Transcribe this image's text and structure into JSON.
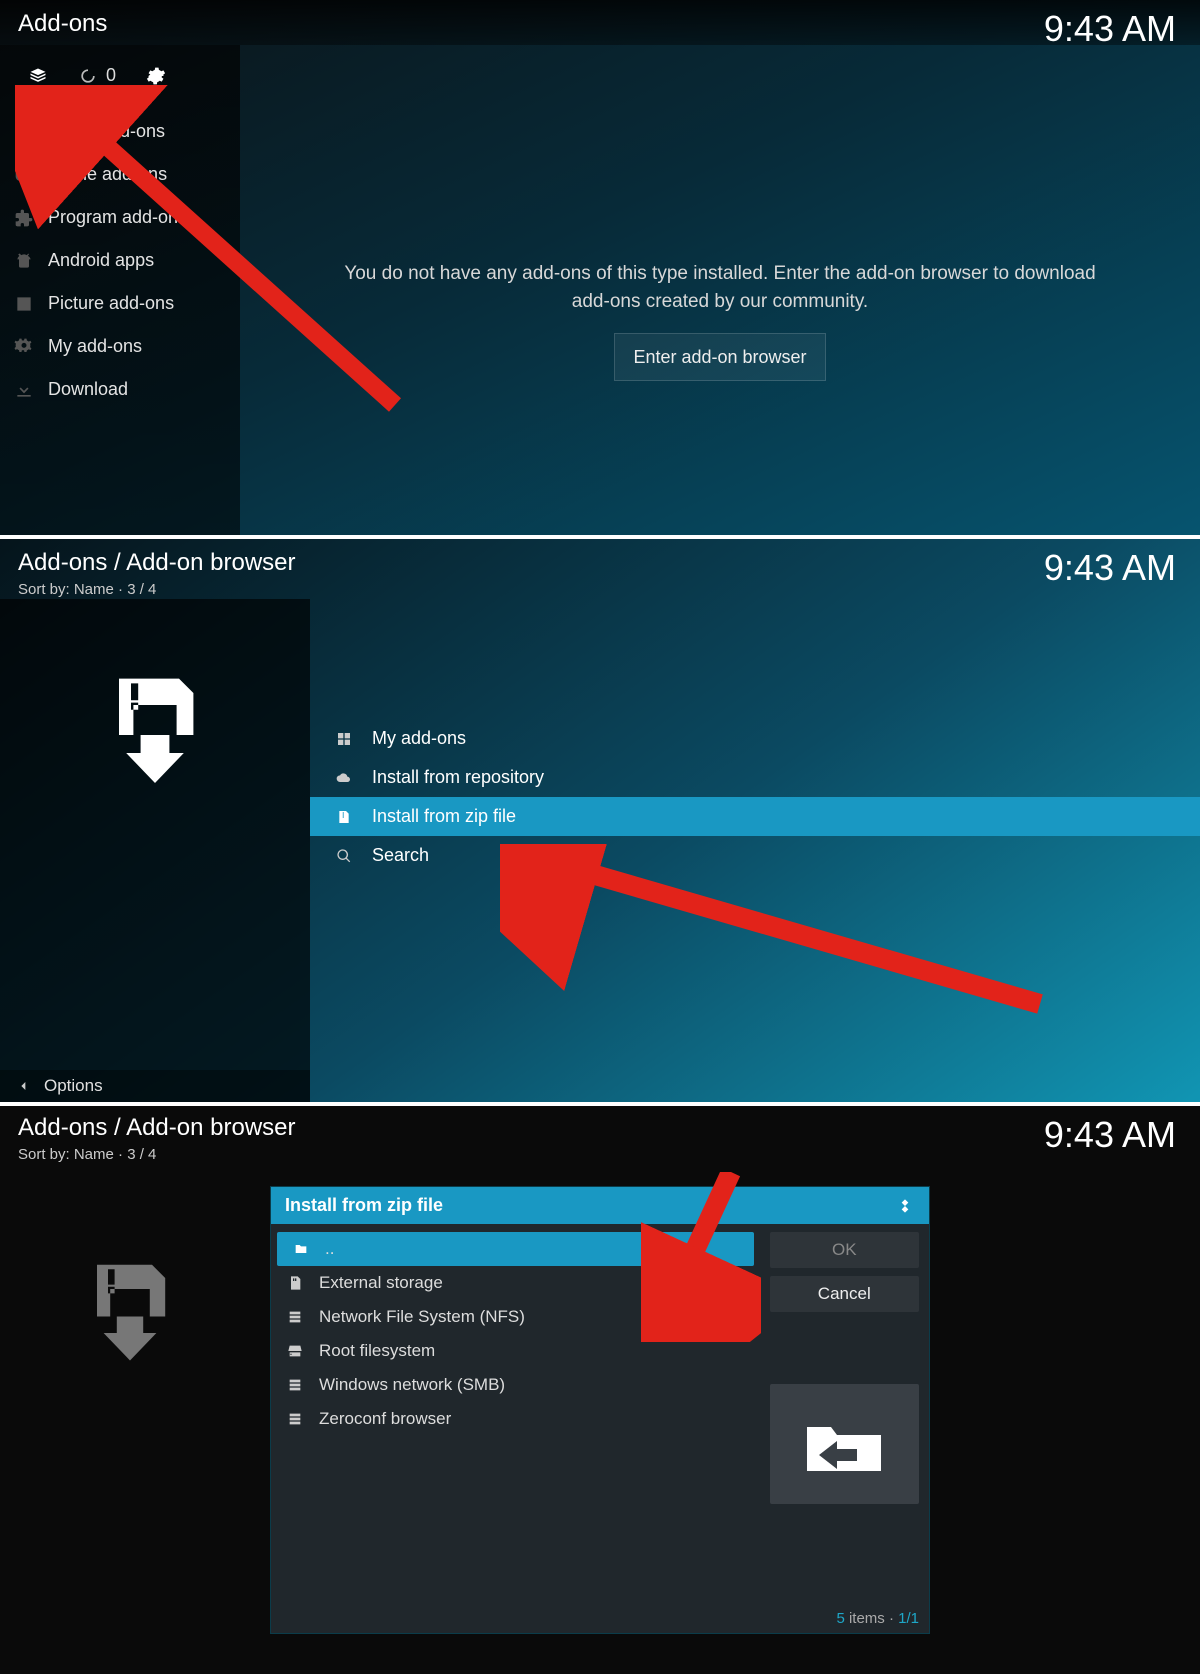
{
  "time": "9:43 AM",
  "panel1": {
    "title": "Add-ons",
    "top_count": "0",
    "sidebar": {
      "items": [
        {
          "label": "Music add-ons",
          "icon": "headphones-icon"
        },
        {
          "label": "Game add-ons",
          "icon": "gamepad-icon"
        },
        {
          "label": "Program add-ons",
          "icon": "puzzle-icon"
        },
        {
          "label": "Android apps",
          "icon": "android-icon"
        },
        {
          "label": "Picture add-ons",
          "icon": "image-icon"
        },
        {
          "label": "My add-ons",
          "icon": "gears-icon"
        },
        {
          "label": "Download",
          "icon": "download-icon"
        }
      ]
    },
    "message": "You do not have any add-ons of this type installed. Enter the add-on browser to download add-ons created by our community.",
    "enter_btn": "Enter add-on browser"
  },
  "panel2": {
    "title": "Add-ons / Add-on browser",
    "sort": "Sort by: Name  ·  3 / 4",
    "items": [
      {
        "label": "My add-ons",
        "hl": false
      },
      {
        "label": "Install from repository",
        "hl": false
      },
      {
        "label": "Install from zip file",
        "hl": true
      },
      {
        "label": "Search",
        "hl": false
      }
    ],
    "options": "Options"
  },
  "panel3": {
    "title": "Add-ons / Add-on browser",
    "sort": "Sort by: Name  ·  3 / 4",
    "dialog": {
      "title": "Install from zip file",
      "items": [
        {
          "label": "..",
          "hl": true
        },
        {
          "label": "External storage",
          "hl": false
        },
        {
          "label": "Network File System (NFS)",
          "hl": false
        },
        {
          "label": "Root filesystem",
          "hl": false
        },
        {
          "label": "Windows network (SMB)",
          "hl": false
        },
        {
          "label": "Zeroconf browser",
          "hl": false
        }
      ],
      "ok": "OK",
      "cancel": "Cancel",
      "count_num": "5",
      "count_label": " items · ",
      "count_page": "1/1"
    }
  }
}
